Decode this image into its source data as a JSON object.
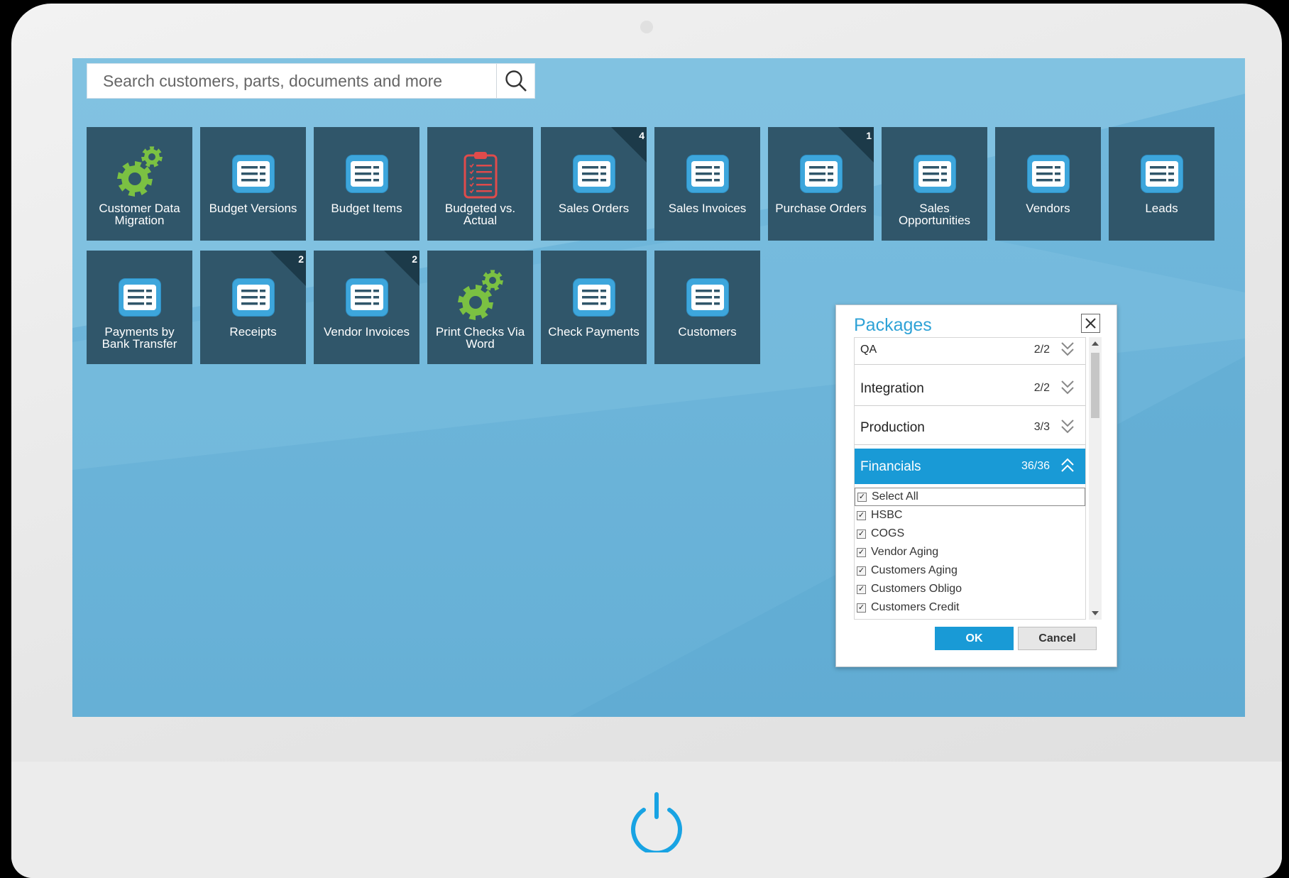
{
  "search": {
    "placeholder": "Search customers, parts, documents and more",
    "icon": "search-icon"
  },
  "colors": {
    "tile_bg": "#30566a",
    "accent": "#199ad6",
    "gear": "#7bc142",
    "clipboard": "#e04b4b",
    "screen_bg": "#6ab3d9"
  },
  "tiles": [
    {
      "id": "customer-data-migration",
      "label": "Customer Data Migration",
      "icon": "gears-icon",
      "badge": ""
    },
    {
      "id": "budget-versions",
      "label": "Budget Versions",
      "icon": "list-icon",
      "badge": ""
    },
    {
      "id": "budget-items",
      "label": "Budget Items",
      "icon": "list-icon",
      "badge": ""
    },
    {
      "id": "budgeted-vs-actual",
      "label": "Budgeted vs. Actual",
      "icon": "clipboard-icon",
      "badge": ""
    },
    {
      "id": "sales-orders",
      "label": "Sales Orders",
      "icon": "list-icon",
      "badge": "4"
    },
    {
      "id": "sales-invoices",
      "label": "Sales Invoices",
      "icon": "list-icon",
      "badge": ""
    },
    {
      "id": "purchase-orders",
      "label": "Purchase Orders",
      "icon": "list-icon",
      "badge": "1"
    },
    {
      "id": "sales-opportunities",
      "label": "Sales Opportunities",
      "icon": "list-icon",
      "badge": ""
    },
    {
      "id": "vendors",
      "label": "Vendors",
      "icon": "list-icon",
      "badge": ""
    },
    {
      "id": "leads",
      "label": "Leads",
      "icon": "list-icon",
      "badge": ""
    },
    {
      "id": "payments-by-bank-transfer",
      "label": "Payments by Bank Transfer",
      "icon": "list-icon",
      "badge": ""
    },
    {
      "id": "receipts",
      "label": "Receipts",
      "icon": "list-icon",
      "badge": "2"
    },
    {
      "id": "vendor-invoices",
      "label": "Vendor Invoices",
      "icon": "list-icon",
      "badge": "2"
    },
    {
      "id": "print-checks-via-word",
      "label": "Print Checks Via Word",
      "icon": "gears-icon",
      "badge": ""
    },
    {
      "id": "check-payments",
      "label": "Check Payments",
      "icon": "list-icon",
      "badge": ""
    },
    {
      "id": "customers",
      "label": "Customers",
      "icon": "list-icon",
      "badge": ""
    }
  ],
  "dialog": {
    "title": "Packages",
    "packages": [
      {
        "name": "QA",
        "count": "2/2",
        "expanded": false
      },
      {
        "name": "Integration",
        "count": "2/2",
        "expanded": false
      },
      {
        "name": "Production",
        "count": "3/3",
        "expanded": false
      },
      {
        "name": "Financials",
        "count": "36/36",
        "expanded": true
      }
    ],
    "items": [
      {
        "label": "Select All",
        "checked": true
      },
      {
        "label": "HSBC",
        "checked": true
      },
      {
        "label": "COGS",
        "checked": true
      },
      {
        "label": "Vendor Aging",
        "checked": true
      },
      {
        "label": "Customers Aging",
        "checked": true
      },
      {
        "label": "Customers Obligo",
        "checked": true
      },
      {
        "label": "Customers Credit",
        "checked": true
      }
    ],
    "ok_label": "OK",
    "cancel_label": "Cancel"
  }
}
